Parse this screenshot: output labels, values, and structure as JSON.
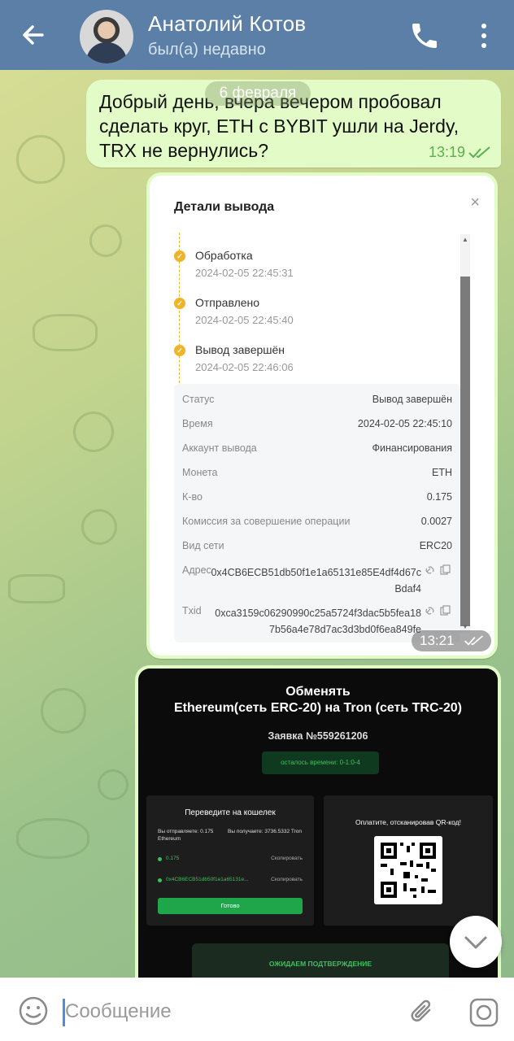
{
  "header": {
    "contact_name": "Анатолий Котов",
    "status": "был(а) недавно"
  },
  "chat": {
    "date_label": "6 февраля",
    "message_text": "Добрый день, вчера вечером пробовал сделать круг, ETH с BYBIT ушли на Jerdy, TRX не вернулись?",
    "message_time": "13:19",
    "image1_time": "13:21"
  },
  "withdrawal": {
    "title": "Детали вывода",
    "close": "×",
    "timeline": [
      {
        "label": "Обработка",
        "time": "2024-02-05 22:45:31"
      },
      {
        "label": "Отправлено",
        "time": "2024-02-05 22:45:40"
      },
      {
        "label": "Вывод завершён",
        "time": "2024-02-05 22:46:06"
      }
    ],
    "rows": [
      {
        "label": "Статус",
        "value": "Вывод завершён"
      },
      {
        "label": "Время",
        "value": "2024-02-05 22:45:10"
      },
      {
        "label": "Аккаунт вывода",
        "value": "Финансирования"
      },
      {
        "label": "Монета",
        "value": "ETH"
      },
      {
        "label": "К-во",
        "value": "0.175"
      },
      {
        "label": "Комиссия за совершение операции",
        "value": "0.0027"
      },
      {
        "label": "Вид сети",
        "value": "ERC20"
      },
      {
        "label": "Адрес",
        "value": "0x4CB6ECB51db50f1e1a65131e85E4df4d67cBdaf4"
      },
      {
        "label": "Txid",
        "value": "0xca3159c06290990c25a5724f3dac5b5fea187b56a4e78d7ac3d3bd0f6ea849fe"
      }
    ]
  },
  "exchange": {
    "title_line1": "Обменять",
    "title_line2": "Ethereum(сеть ERC-20) на Tron (сеть TRC-20)",
    "order": "Заявка №559261206",
    "timer": "осталось времени: 0-1:0-4",
    "left_title": "Переведите на кошелек",
    "send_label": "Вы отправляете: 0.175 Ethereum",
    "recv_label": "Вы получаете: 3736.5332 Tron",
    "amount": "0.175",
    "address_short": "0x4CB6ECB51db50f1e1a65131e...",
    "copy": "Скопировать",
    "done": "Готово",
    "right_title": "Оплатите, отсканировав QR-код!",
    "waiting": "ОЖИДАЕМ ПОДТВЕРЖДЕНИЕ"
  },
  "input": {
    "placeholder": "Сообщение"
  },
  "colors": {
    "header": "#5b7fa6",
    "outgoing_bubble": "#e3fcc7",
    "accent_green": "#3fbf5f",
    "timeline_dot": "#f0b429"
  },
  "icons": [
    "back-arrow-icon",
    "phone-icon",
    "more-vertical-icon",
    "double-check-icon",
    "chevron-down-icon",
    "emoji-icon",
    "paperclip-icon",
    "camera-icon",
    "link-icon",
    "copy-icon",
    "qr-code-icon"
  ]
}
